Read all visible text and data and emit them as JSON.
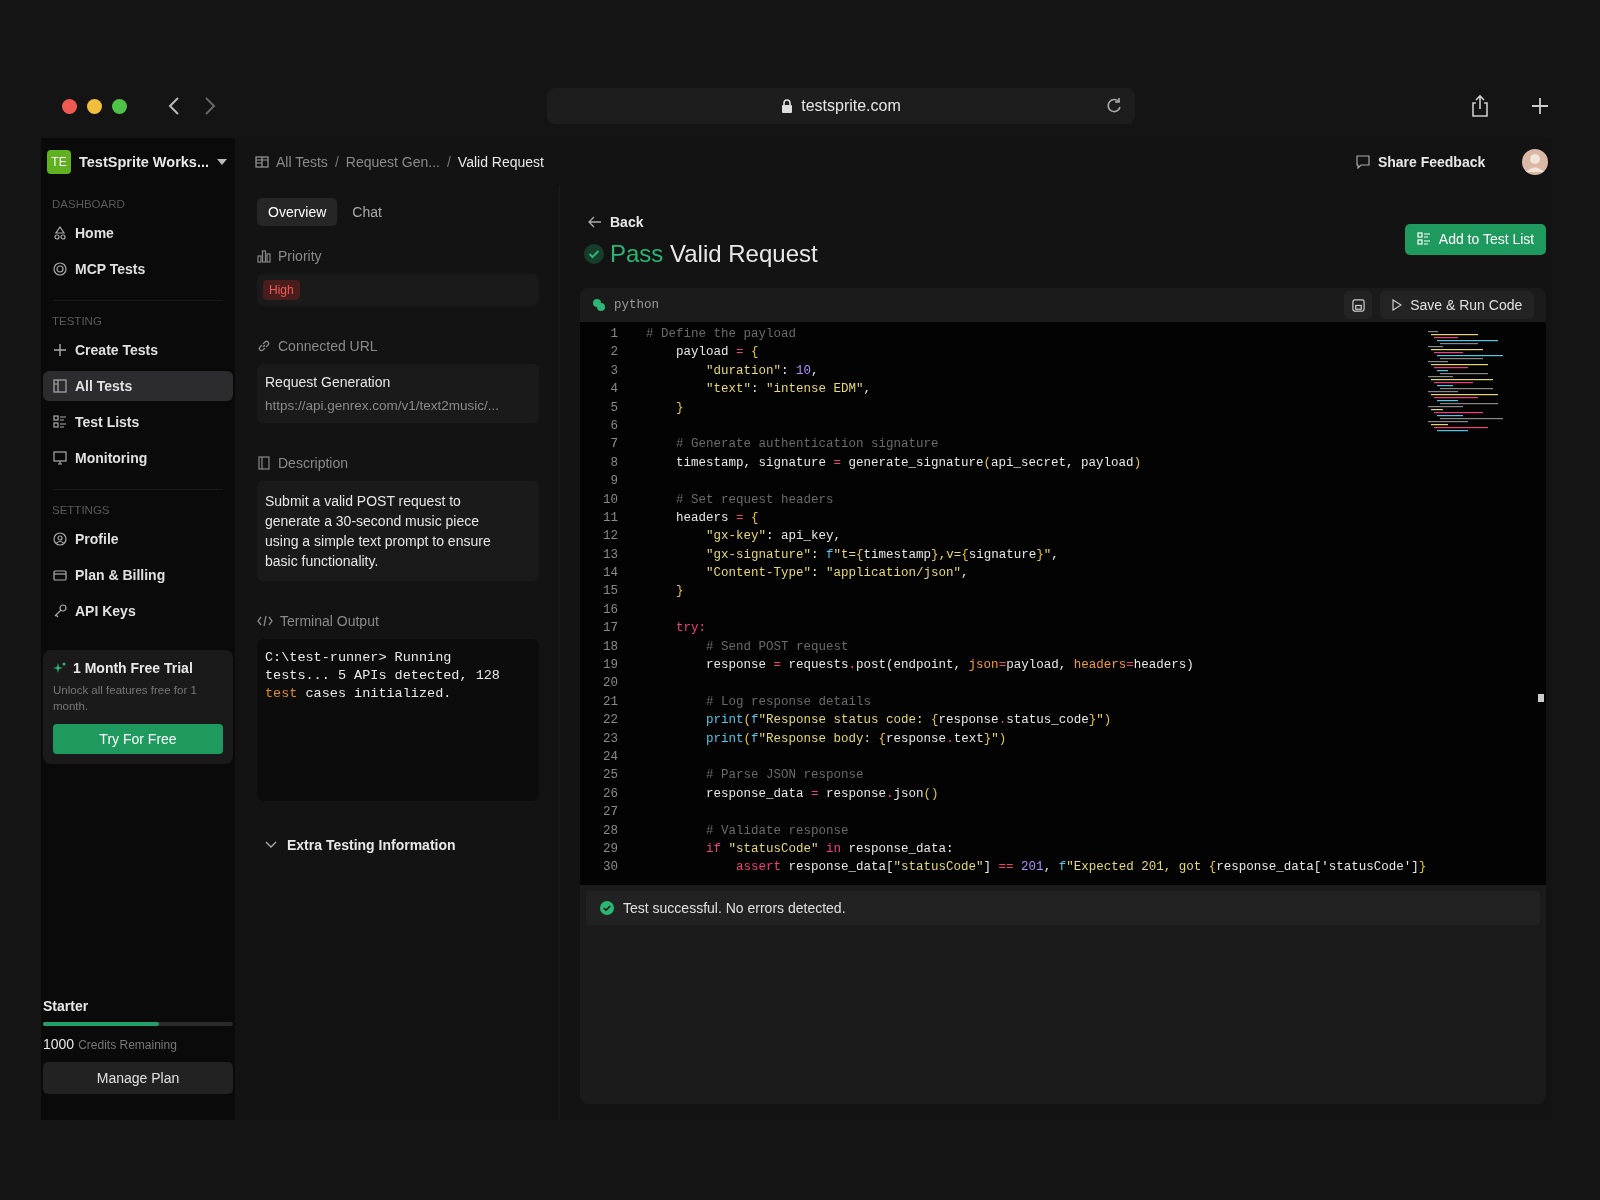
{
  "browser": {
    "url": "testsprite.com"
  },
  "sidebar": {
    "workspace": {
      "initials": "TE",
      "name": "TestSprite Works..."
    },
    "sections": [
      {
        "label": "DASHBOARD",
        "items": [
          {
            "label": "Home",
            "selected": false
          },
          {
            "label": "MCP Tests",
            "selected": false
          }
        ]
      },
      {
        "label": "TESTING",
        "items": [
          {
            "label": "Create Tests",
            "selected": false
          },
          {
            "label": "All Tests",
            "selected": true
          },
          {
            "label": "Test Lists",
            "selected": false
          },
          {
            "label": "Monitoring",
            "selected": false
          }
        ]
      },
      {
        "label": "SETTINGS",
        "items": [
          {
            "label": "Profile",
            "selected": false
          },
          {
            "label": "Plan & Billing",
            "selected": false
          },
          {
            "label": "API Keys",
            "selected": false
          }
        ]
      }
    ],
    "trial": {
      "title": "1 Month Free Trial",
      "text": "Unlock all features free for 1 month.",
      "button": "Try For Free"
    },
    "plan": {
      "name": "Starter",
      "level": 0.61,
      "credits": "1000",
      "credits_label": "Credits Remaining",
      "button": "Manage Plan"
    }
  },
  "breadcrumb": [
    {
      "label": "All Tests"
    },
    {
      "separator": "/",
      "label": "Request Gen..."
    },
    {
      "separator": "/",
      "label": "Valid Request"
    }
  ],
  "share_feedback": "Share Feedback",
  "tabs": [
    {
      "label": "Overview",
      "selected": true
    },
    {
      "label": "Chat",
      "selected": false
    }
  ],
  "priority": {
    "label": "Priority",
    "value": "High"
  },
  "connected_url": {
    "label": "Connected URL",
    "name": "Request Generation",
    "url": "https://api.genrex.com/v1/text2music/..."
  },
  "description": {
    "label": "Description",
    "text": "Submit a valid POST request to generate a 30-second music piece using a simple text prompt to ensure basic functionality."
  },
  "terminal": {
    "label": "Terminal Output",
    "tokens": [
      {
        "kind": "plain",
        "text": "C:\\test-runner> Running tests... 5 APIs detected, 128 "
      },
      {
        "kind": "keyword",
        "text": "test"
      },
      {
        "kind": "plain",
        "text": " cases initialized."
      }
    ]
  },
  "extra_info": {
    "label": "Extra Testing Information",
    "expanded": false
  },
  "back": "Back",
  "result": {
    "status": "Pass",
    "title": "Valid Request"
  },
  "add_button": "Add to Test List",
  "editor": {
    "language": "python",
    "run_button": "Save & Run Code",
    "lines": [
      {
        "number": "1",
        "tokens": [
          {
            "kind": "comment",
            "text": "# Define the payload"
          }
        ]
      },
      {
        "number": "2",
        "tokens": [
          {
            "kind": "plain",
            "text": "    payload "
          },
          {
            "kind": "op",
            "text": "= "
          },
          {
            "kind": "brace",
            "text": "{"
          }
        ]
      },
      {
        "number": "3",
        "tokens": [
          {
            "kind": "string",
            "text": "        \"duration\""
          },
          {
            "kind": "plain",
            "text": ": "
          },
          {
            "kind": "number",
            "text": "10"
          },
          {
            "kind": "plain",
            "text": ","
          }
        ]
      },
      {
        "number": "4",
        "tokens": [
          {
            "kind": "string",
            "text": "        \"text\""
          },
          {
            "kind": "plain",
            "text": ": "
          },
          {
            "kind": "string",
            "text": "\"intense EDM\""
          },
          {
            "kind": "plain",
            "text": ","
          }
        ]
      },
      {
        "number": "5",
        "tokens": [
          {
            "kind": "brace",
            "text": "    }"
          }
        ]
      },
      {
        "number": "6"
      },
      {
        "number": "7",
        "tokens": [
          {
            "kind": "comment",
            "text": "    # Generate authentication signature"
          }
        ]
      },
      {
        "number": "8",
        "tokens": [
          {
            "kind": "plain",
            "text": "    timestamp, signature "
          },
          {
            "kind": "op",
            "text": "="
          },
          {
            "kind": "plain",
            "text": " generate_signature"
          },
          {
            "kind": "brace",
            "text": "("
          },
          {
            "kind": "plain",
            "text": "api_secret, payload"
          },
          {
            "kind": "brace",
            "text": ")"
          }
        ]
      },
      {
        "number": "9"
      },
      {
        "number": "10",
        "tokens": [
          {
            "kind": "comment",
            "text": "    # Set request headers"
          }
        ]
      },
      {
        "number": "11",
        "tokens": [
          {
            "kind": "plain",
            "text": "    headers "
          },
          {
            "kind": "op",
            "text": "= "
          },
          {
            "kind": "brace",
            "text": "{"
          }
        ]
      },
      {
        "number": "12",
        "tokens": [
          {
            "kind": "string",
            "text": "        \"gx-key\""
          },
          {
            "kind": "plain",
            "text": ": api_key,"
          }
        ]
      },
      {
        "number": "13",
        "tokens": [
          {
            "kind": "string",
            "text": "        \"gx-signature\""
          },
          {
            "kind": "plain",
            "text": ": "
          },
          {
            "kind": "fn",
            "text": "f"
          },
          {
            "kind": "string",
            "text": "\"t="
          },
          {
            "kind": "brace",
            "text": "{"
          },
          {
            "kind": "plain",
            "text": "timestamp"
          },
          {
            "kind": "brace",
            "text": "}"
          },
          {
            "kind": "string",
            "text": ",v="
          },
          {
            "kind": "brace",
            "text": "{"
          },
          {
            "kind": "plain",
            "text": "signature"
          },
          {
            "kind": "brace",
            "text": "}"
          },
          {
            "kind": "string",
            "text": "\""
          },
          {
            "kind": "plain",
            "text": ","
          }
        ]
      },
      {
        "number": "14",
        "tokens": [
          {
            "kind": "string",
            "text": "        \"Content-Type\""
          },
          {
            "kind": "plain",
            "text": ": "
          },
          {
            "kind": "string",
            "text": "\"application/json\""
          },
          {
            "kind": "plain",
            "text": ","
          }
        ]
      },
      {
        "number": "15",
        "tokens": [
          {
            "kind": "brace",
            "text": "    }"
          }
        ]
      },
      {
        "number": "16"
      },
      {
        "number": "17",
        "tokens": [
          {
            "kind": "keyword",
            "text": "    try:"
          }
        ]
      },
      {
        "number": "18",
        "tokens": [
          {
            "kind": "comment",
            "text": "        # Send POST request"
          }
        ]
      },
      {
        "number": "19",
        "tokens": [
          {
            "kind": "plain",
            "text": "        response "
          },
          {
            "kind": "op",
            "text": "="
          },
          {
            "kind": "plain",
            "text": " requests"
          },
          {
            "kind": "op",
            "text": "."
          },
          {
            "kind": "plain",
            "text": "post(endpoint, "
          },
          {
            "kind": "param",
            "text": "json"
          },
          {
            "kind": "op",
            "text": "="
          },
          {
            "kind": "plain",
            "text": "payload, "
          },
          {
            "kind": "param",
            "text": "headers"
          },
          {
            "kind": "op",
            "text": "="
          },
          {
            "kind": "plain",
            "text": "headers)"
          }
        ]
      },
      {
        "number": "20"
      },
      {
        "number": "21",
        "tokens": [
          {
            "kind": "comment",
            "text": "        # Log response details"
          }
        ]
      },
      {
        "number": "22",
        "tokens": [
          {
            "kind": "fn",
            "text": "        print"
          },
          {
            "kind": "brace",
            "text": "("
          },
          {
            "kind": "fn",
            "text": "f"
          },
          {
            "kind": "string",
            "text": "\"Response status code: "
          },
          {
            "kind": "brace",
            "text": "{"
          },
          {
            "kind": "plain",
            "text": "response"
          },
          {
            "kind": "op",
            "text": "."
          },
          {
            "kind": "plain",
            "text": "status_code"
          },
          {
            "kind": "brace",
            "text": "}"
          },
          {
            "kind": "string",
            "text": "\""
          },
          {
            "kind": "brace",
            "text": ")"
          }
        ]
      },
      {
        "number": "23",
        "tokens": [
          {
            "kind": "fn",
            "text": "        print"
          },
          {
            "kind": "brace",
            "text": "("
          },
          {
            "kind": "fn",
            "text": "f"
          },
          {
            "kind": "string",
            "text": "\"Response body: "
          },
          {
            "kind": "brace",
            "text": "{"
          },
          {
            "kind": "plain",
            "text": "response"
          },
          {
            "kind": "op",
            "text": "."
          },
          {
            "kind": "plain",
            "text": "text"
          },
          {
            "kind": "brace",
            "text": "}"
          },
          {
            "kind": "string",
            "text": "\""
          },
          {
            "kind": "brace",
            "text": ")"
          }
        ]
      },
      {
        "number": "24"
      },
      {
        "number": "25",
        "tokens": [
          {
            "kind": "comment",
            "text": "        # Parse JSON response"
          }
        ]
      },
      {
        "number": "26",
        "tokens": [
          {
            "kind": "plain",
            "text": "        response_data "
          },
          {
            "kind": "op",
            "text": "="
          },
          {
            "kind": "plain",
            "text": " response"
          },
          {
            "kind": "op",
            "text": "."
          },
          {
            "kind": "plain",
            "text": "json"
          },
          {
            "kind": "brace",
            "text": "()"
          }
        ]
      },
      {
        "number": "27"
      },
      {
        "number": "28",
        "tokens": [
          {
            "kind": "comment",
            "text": "        # Validate response"
          }
        ]
      },
      {
        "number": "29",
        "tokens": [
          {
            "kind": "keyword",
            "text": "        if"
          },
          {
            "kind": "string",
            "text": " \"statusCode\""
          },
          {
            "kind": "keyword",
            "text": " in"
          },
          {
            "kind": "plain",
            "text": " response_data:"
          }
        ]
      },
      {
        "number": "30",
        "tokens": [
          {
            "kind": "keyword",
            "text": "            assert"
          },
          {
            "kind": "plain",
            "text": " response_data["
          },
          {
            "kind": "string",
            "text": "\"statusCode\""
          },
          {
            "kind": "plain",
            "text": "] "
          },
          {
            "kind": "op",
            "text": "=="
          },
          {
            "kind": "number",
            "text": " 201"
          },
          {
            "kind": "plain",
            "text": ", "
          },
          {
            "kind": "fn",
            "text": "f"
          },
          {
            "kind": "string",
            "text": "\"Expected 201, got "
          },
          {
            "kind": "brace",
            "text": "{"
          },
          {
            "kind": "plain",
            "text": "response_data['statusCode']"
          },
          {
            "kind": "brace",
            "text": "}"
          }
        ]
      }
    ]
  },
  "status_message": "Test successful. No errors detected."
}
